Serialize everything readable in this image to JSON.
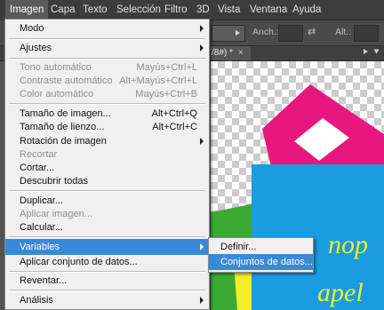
{
  "menubar": {
    "items": [
      "Imagen",
      "Capa",
      "Texto",
      "Selección",
      "Filtro",
      "3D",
      "Vista",
      "Ventana",
      "Ayuda"
    ],
    "active": "Imagen"
  },
  "options_bar": {
    "width_label": "Anch.:",
    "height_label": "Alt.:",
    "swap_symbol": "⇄"
  },
  "document_tab": {
    "title": "/8#) *",
    "close": "×"
  },
  "image_menu": {
    "items": [
      {
        "label": "Modo",
        "submenu": true
      },
      {
        "label": "Ajustes",
        "submenu": true
      },
      {
        "label": "Tono automático",
        "shortcut": "Mayús+Ctrl+L",
        "disabled": true
      },
      {
        "label": "Contraste automático",
        "shortcut": "Alt+Mayús+Ctrl+L",
        "disabled": true
      },
      {
        "label": "Color automático",
        "shortcut": "Mayús+Ctrl+B",
        "disabled": true
      },
      {
        "label": "Tamaño de imagen...",
        "shortcut": "Alt+Ctrl+Q"
      },
      {
        "label": "Tamaño de lienzo...",
        "shortcut": "Alt+Ctrl+C"
      },
      {
        "label": "Rotación de imagen",
        "submenu": true
      },
      {
        "label": "Recortar",
        "disabled": true
      },
      {
        "label": "Cortar..."
      },
      {
        "label": "Descubrir todas"
      },
      {
        "label": "Duplicar..."
      },
      {
        "label": "Aplicar imagen...",
        "disabled": true
      },
      {
        "label": "Calcular..."
      },
      {
        "label": "Variables",
        "submenu": true,
        "highlighted": true
      },
      {
        "label": "Aplicar conjunto de datos..."
      },
      {
        "label": "Reventar..."
      },
      {
        "label": "Análisis",
        "submenu": true
      }
    ]
  },
  "variables_submenu": {
    "items": [
      {
        "label": "Definir..."
      },
      {
        "label": "Conjuntos de datos...",
        "highlighted": true
      }
    ]
  },
  "canvas_art": {
    "text": "nop\napel",
    "colors": {
      "magenta": "#e8177d",
      "blue": "#1b9be0",
      "yellow": "#f2ee2a",
      "green": "#3aaa35"
    }
  },
  "colors": {
    "highlight": "#3a89d8",
    "menu_bg": "#f0f0f0",
    "ps_dark": "#3c3c3c"
  }
}
